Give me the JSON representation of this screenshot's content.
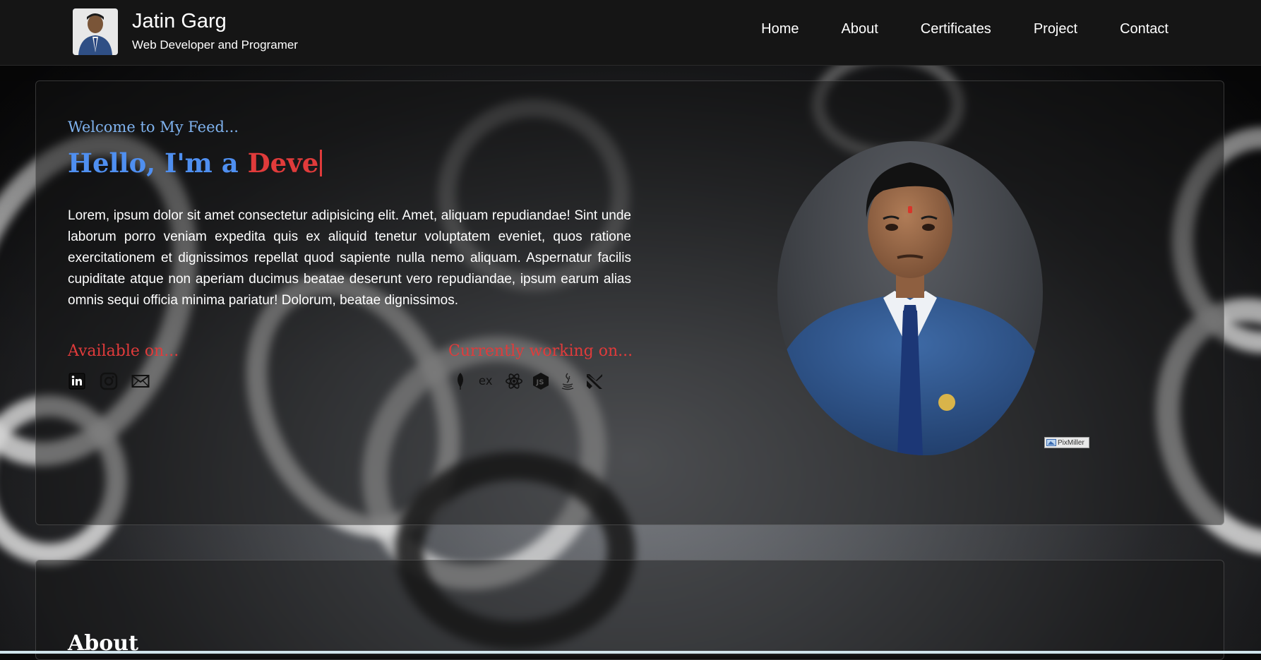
{
  "header": {
    "name": "Jatin Garg",
    "subtitle": "Web Developer and Programer",
    "nav": [
      "Home",
      "About",
      "Certificates",
      "Project",
      "Contact"
    ]
  },
  "hero": {
    "welcome": "Welcome to My Feed...",
    "hello_prefix": "Hello, I'm a ",
    "hello_typed": "Deve",
    "lorem": "Lorem, ipsum dolor sit amet consectetur adipisicing elit. Amet, aliquam repudiandae! Sint unde laborum porro veniam expedita quis ex aliquid tenetur voluptatem eveniet, quos ratione exercitationem et dignissimos repellat quod sapiente nulla nemo aliquam. Aspernatur facilis cupiditate atque non aperiam ducimus beatae deserunt vero repudiandae, ipsum earum alias omnis sequi officia minima pariatur! Dolorum, beatae dignissimos.",
    "available_title": "Available on...",
    "working_title": "Currently working on...",
    "social_icons": [
      "linkedin-icon",
      "instagram-icon",
      "mail-icon"
    ],
    "tech_icons": [
      "mongodb-icon",
      "express-icon",
      "react-icon",
      "nodejs-icon",
      "java-icon",
      "next-icon"
    ],
    "watermark": "PixMiller"
  },
  "about": {
    "title": "About"
  },
  "colors": {
    "accent_blue": "#4f8ff0",
    "accent_red": "#e03b3b",
    "welcome_blue": "#7fb2ee"
  }
}
